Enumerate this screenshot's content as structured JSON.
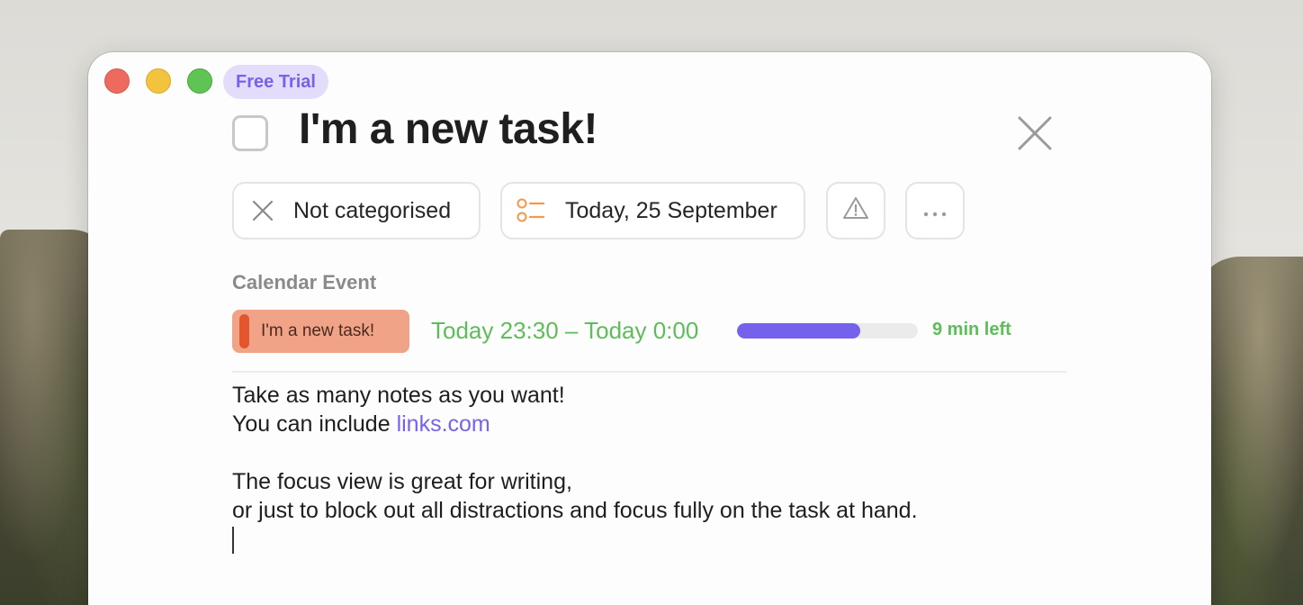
{
  "window": {
    "trial_badge": "Free Trial"
  },
  "task": {
    "title": "I'm a new task!",
    "completed": false
  },
  "toolbar": {
    "category_label": "Not categorised",
    "category_icon": "x-icon",
    "date_label": "Today, 25 September",
    "date_icon": "list-icon",
    "priority_icon": "warning-icon",
    "more_icon": "more-icon"
  },
  "calendar_event": {
    "section_label": "Calendar Event",
    "chip_label": "I'm a new task!",
    "time_range": "Today 23:30 – Today 0:00",
    "progress_fraction": 0.68,
    "time_left": "9 min left"
  },
  "notes": {
    "line1": "Take as many notes as you want!",
    "line2_prefix": "You can include ",
    "line2_link": "links.com",
    "line3": "The focus view is great for writing,",
    "line4": "or just to block out all distractions and focus fully on the task at hand."
  },
  "colors": {
    "accent": "#7a62e6",
    "progress": "#7462ed",
    "event_time_green": "#5ebd5a",
    "event_chip_bg": "#f0a387",
    "event_chip_bar": "#e2552d",
    "date_icon_orange": "#f2994a"
  }
}
